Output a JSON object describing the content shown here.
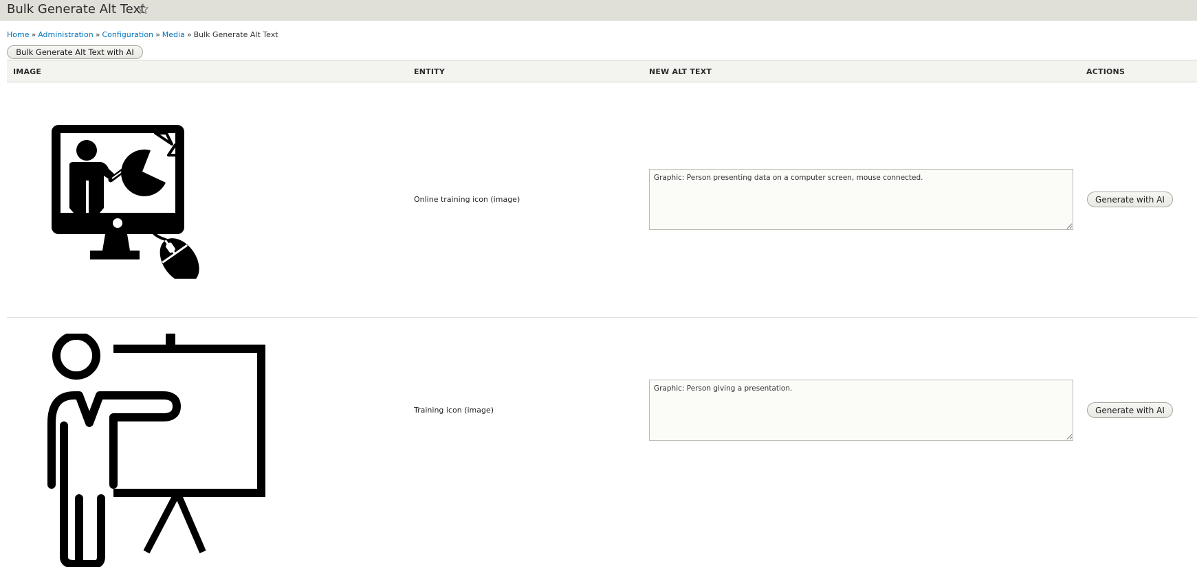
{
  "header": {
    "title": "Bulk Generate Alt Text",
    "star_icon": "star-outline-icon"
  },
  "breadcrumb": {
    "items": [
      "Home",
      "Administration",
      "Configuration",
      "Media"
    ],
    "separator": "»",
    "current": "Bulk Generate Alt Text"
  },
  "toolbar": {
    "bulk_label": "Bulk Generate Alt Text with AI"
  },
  "table": {
    "headers": [
      "Image",
      "Entity",
      "New Alt Text",
      "Actions"
    ],
    "rows": [
      {
        "image_icon": "online-training-icon",
        "entity": "Online training icon (image)",
        "alt_text": "Graphic: Person presenting data on a computer screen, mouse connected.",
        "action_label": "Generate with AI"
      },
      {
        "image_icon": "presentation-training-icon",
        "entity": "Training icon (image)",
        "alt_text": "Graphic: Person giving a presentation.",
        "action_label": "Generate with AI"
      }
    ]
  },
  "colors": {
    "link": "#0074bd",
    "title_bar": "#e0e0d8",
    "table_header": "#f3f3f0"
  }
}
